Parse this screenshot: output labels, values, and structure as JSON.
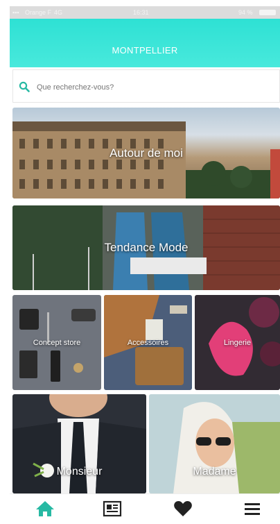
{
  "status_bar": {
    "carrier": "Orange F",
    "network": "4G",
    "time": "16:31",
    "battery": "94 %"
  },
  "header": {
    "title": "MONTPELLIER"
  },
  "search": {
    "placeholder": "Que recherchez-vous?"
  },
  "tiles": [
    {
      "label": "Autour de moi"
    },
    {
      "label": "Tendance Mode"
    },
    {
      "label": "Concept store"
    },
    {
      "label": "Accessoires"
    },
    {
      "label": "Lingerie"
    },
    {
      "label": "Monsieur"
    },
    {
      "label": "Madame"
    }
  ],
  "tabbar": {
    "items": [
      {
        "icon": "home-icon",
        "active": true
      },
      {
        "icon": "newspaper-icon",
        "active": false
      },
      {
        "icon": "heart-icon",
        "active": false
      },
      {
        "icon": "menu-icon",
        "active": false
      }
    ]
  },
  "colors": {
    "accent": "#2ee1d4",
    "tab_active": "#27b9a3",
    "tab_inactive": "#222222"
  }
}
